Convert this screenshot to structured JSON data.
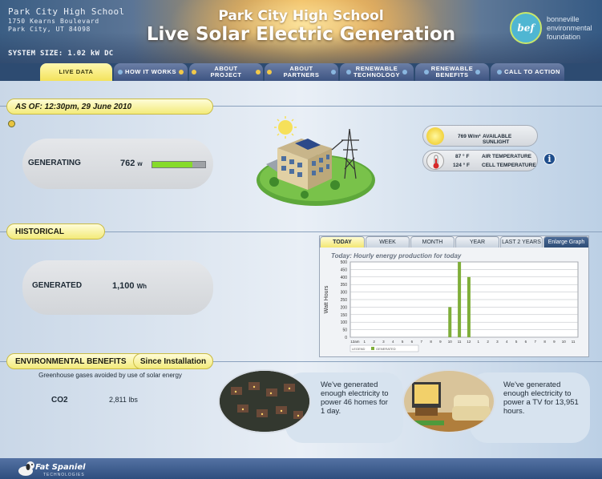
{
  "header": {
    "address": {
      "name": "Park City High School",
      "line1": "1750 Kearns Boulevard",
      "line2": "Park City, UT 84098"
    },
    "system_size": "SYSTEM SIZE: 1.02 kW DC",
    "school_title": "Park City High School",
    "page_title": "Live Solar Electric Generation",
    "logo_text": "bef",
    "logo_lines": [
      "bonneville",
      "environmental",
      "foundation"
    ]
  },
  "nav": {
    "tabs": [
      {
        "label": "LIVE DATA",
        "active": true
      },
      {
        "label": "HOW IT WORKS",
        "active": false
      },
      {
        "label": "ABOUT PROJECT",
        "active": false
      },
      {
        "label": "ABOUT PARTNERS",
        "active": false
      },
      {
        "label": "RENEWABLE\nTECHNOLOGY",
        "active": false
      },
      {
        "label": "RENEWABLE\nBENEFITS",
        "active": false
      },
      {
        "label": "CALL TO ACTION",
        "active": false
      }
    ]
  },
  "live": {
    "as_of": "AS OF: 12:30pm, 29 June 2010",
    "generating_label": "GENERATING",
    "generating_value": "762",
    "generating_unit": "w",
    "generating_fraction": 0.75,
    "sunlight_value": "769",
    "sunlight_unit": "W/m²",
    "sunlight_label": "AVAILABLE SUNLIGHT",
    "air_temp_value": "87 ° F",
    "air_temp_label": "AIR TEMPERATURE",
    "cell_temp_value": "124 ° F",
    "cell_temp_label": "CELL TEMPERATURE",
    "info_glyph": "i"
  },
  "historical": {
    "section_label": "HISTORICAL",
    "generated_label": "GENERATED",
    "generated_value": "1,100",
    "generated_unit": "Wh",
    "chart_tabs": [
      "TODAY",
      "WEEK",
      "MONTH",
      "YEAR",
      "LAST 2 YEARS",
      "Enlarge Graph"
    ],
    "chart_title": "Today: Hourly energy production for today",
    "legend_label": "LEGEND",
    "legend_series": "GENERATED",
    "series_color": "#7fae3a"
  },
  "chart_data": {
    "type": "bar",
    "title": "Today: Hourly energy production for today",
    "xlabel": "",
    "ylabel": "Watt Hours",
    "ylim": [
      0,
      500
    ],
    "yticks": [
      0,
      50,
      100,
      150,
      200,
      250,
      300,
      350,
      400,
      450,
      500
    ],
    "grid": true,
    "legend_placement": "bottom-left",
    "categories": [
      "12am",
      "1",
      "2",
      "3",
      "4",
      "5",
      "6",
      "7",
      "8",
      "9",
      "10",
      "11",
      "12",
      "1",
      "2",
      "3",
      "4",
      "5",
      "6",
      "7",
      "8",
      "9",
      "10",
      "11"
    ],
    "series": [
      {
        "name": "GENERATED",
        "values": [
          0,
          0,
          0,
          0,
          0,
          0,
          0,
          0,
          0,
          0,
          200,
          500,
          400,
          0,
          0,
          0,
          0,
          0,
          0,
          0,
          0,
          0,
          0,
          0
        ]
      }
    ]
  },
  "environment": {
    "section_label": "ENVIRONMENTAL BENEFITS",
    "since_label": "Since Installation",
    "subtitle": "Greenhouse gases avoided by use of solar energy",
    "co2_label": "CO2",
    "co2_value": "2,811 lbs",
    "homes_text": "We've generated enough electricity to power 46 homes for 1 day.",
    "tv_text": "We've generated enough electricity to power a TV for 13,951 hours."
  },
  "footer": {
    "brand": "Fat Spaniel",
    "sub": "TECHNOLOGIES"
  }
}
